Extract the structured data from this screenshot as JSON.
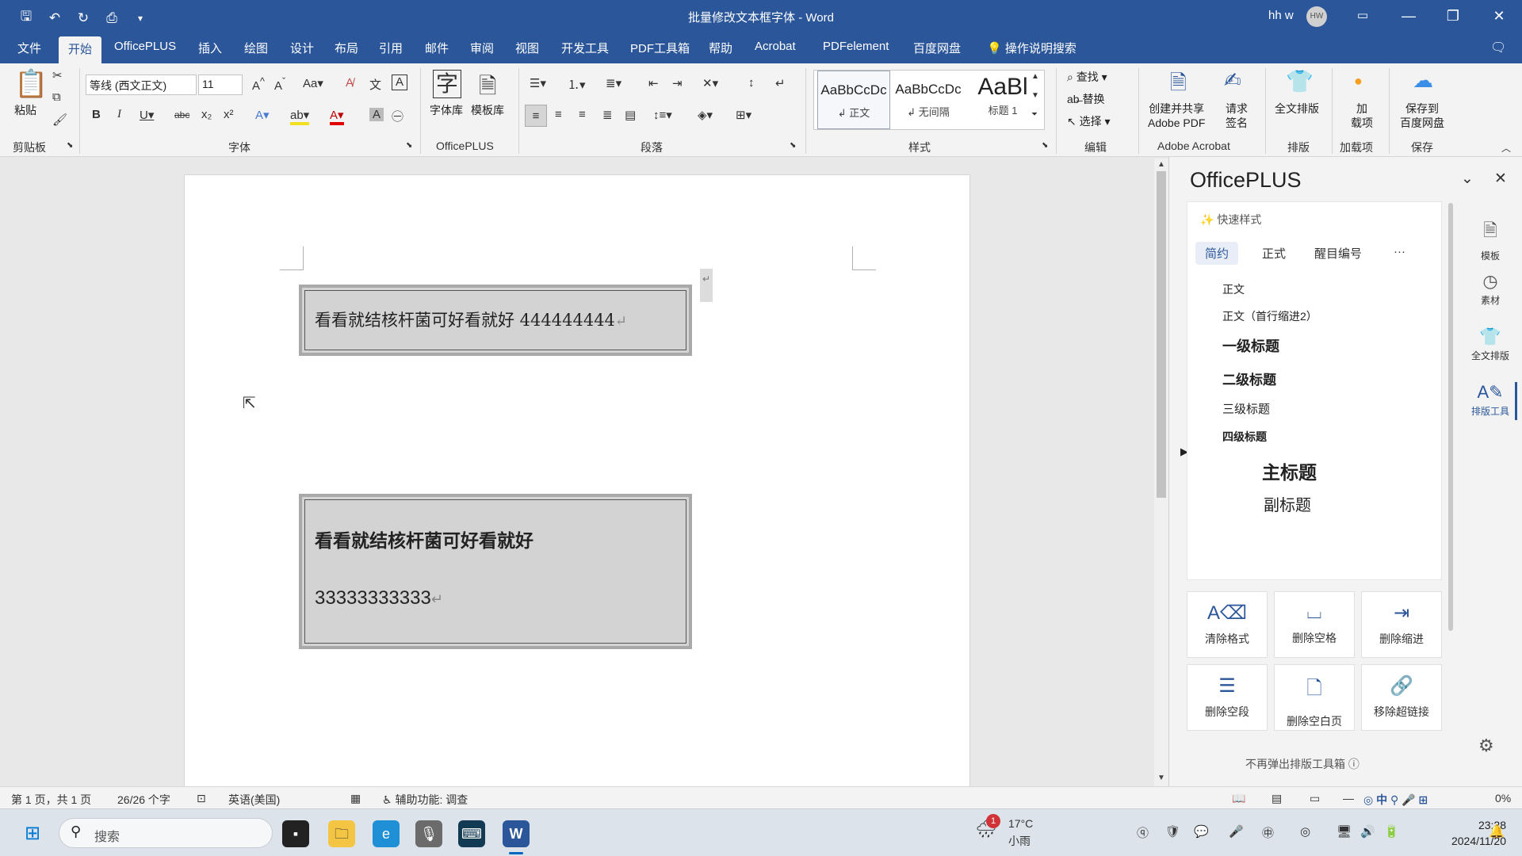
{
  "window": {
    "title": "批量修改文本框字体  -  Word",
    "user_name": "hh w",
    "user_initials": "HW",
    "qat_icons": [
      "save-icon",
      "undo-icon",
      "redo-icon",
      "print-preview-icon",
      "customize-icon"
    ]
  },
  "tabs": [
    "文件",
    "开始",
    "OfficePLUS",
    "插入",
    "绘图",
    "设计",
    "布局",
    "引用",
    "邮件",
    "审阅",
    "视图",
    "开发工具",
    "PDF工具箱",
    "帮助",
    "Acrobat",
    "PDFelement",
    "百度网盘"
  ],
  "active_tab": "开始",
  "tell_me": "操作说明搜索",
  "ribbon": {
    "clipboard": {
      "paste": "粘贴",
      "group": "剪贴板"
    },
    "font": {
      "font_name": "等线 (西文正文)",
      "font_size": "11",
      "group": "字体"
    },
    "officeplus": {
      "fontlib": "字体库",
      "templatelib": "模板库",
      "group": "OfficePLUS"
    },
    "paragraph": {
      "group": "段落"
    },
    "styles": {
      "items": [
        {
          "preview": "AaBbCcDc",
          "name": "↲ 正文"
        },
        {
          "preview": "AaBbCcDc",
          "name": "↲ 无间隔"
        },
        {
          "preview": "AaBl",
          "name": "标题 1"
        }
      ],
      "group": "样式"
    },
    "editing": {
      "find": "查找",
      "replace": "替换",
      "select": "选择",
      "group": "编辑"
    },
    "acrobat": {
      "create_share": "创建并共享",
      "adobe_pdf": "Adobe PDF",
      "request_sign_1": "请求",
      "request_sign_2": "签名",
      "group": "Adobe Acrobat"
    },
    "layout": {
      "full_layout": "全文排版",
      "group": "排版"
    },
    "addins": {
      "label_1": "加",
      "label_2": "载项",
      "group": "加载项"
    },
    "save": {
      "label_1": "保存到",
      "label_2": "百度网盘",
      "group": "保存"
    }
  },
  "document": {
    "textbox1": "看看就结核杆菌可好看就好 444444444",
    "textbox2_line1": "看看就结核杆菌可好看就好",
    "textbox2_line2": "33333333333",
    "para_mark": "↵"
  },
  "panel": {
    "title": "OfficePLUS",
    "quick_style": "快速样式",
    "style_tabs": [
      "简约",
      "正式",
      "醒目编号",
      "···"
    ],
    "style_items": [
      "正文",
      "正文（首行缩进2）",
      "一级标题",
      "二级标题",
      "三级标题",
      "四级标题",
      "主标题",
      "副标题"
    ],
    "tools": [
      "清除格式",
      "删除空格",
      "删除缩进",
      "删除空段",
      "删除空白页",
      "移除超链接"
    ],
    "footer": "不再弹出排版工具箱 ⓘ",
    "rail": [
      "模板",
      "素材",
      "全文排版",
      "排版工具"
    ]
  },
  "statusbar": {
    "page": "第 1 页，共 1 页",
    "words": "26/26 个字",
    "language": "英语(美国)",
    "accessibility": "辅助功能: 调查",
    "zoom": "0%"
  },
  "taskbar": {
    "search_placeholder": "搜索",
    "weather_temp": "17°C",
    "weather_desc": "小雨",
    "weather_badge": "1",
    "ime": "中",
    "time": "23:28",
    "date": "2024/11/20"
  }
}
